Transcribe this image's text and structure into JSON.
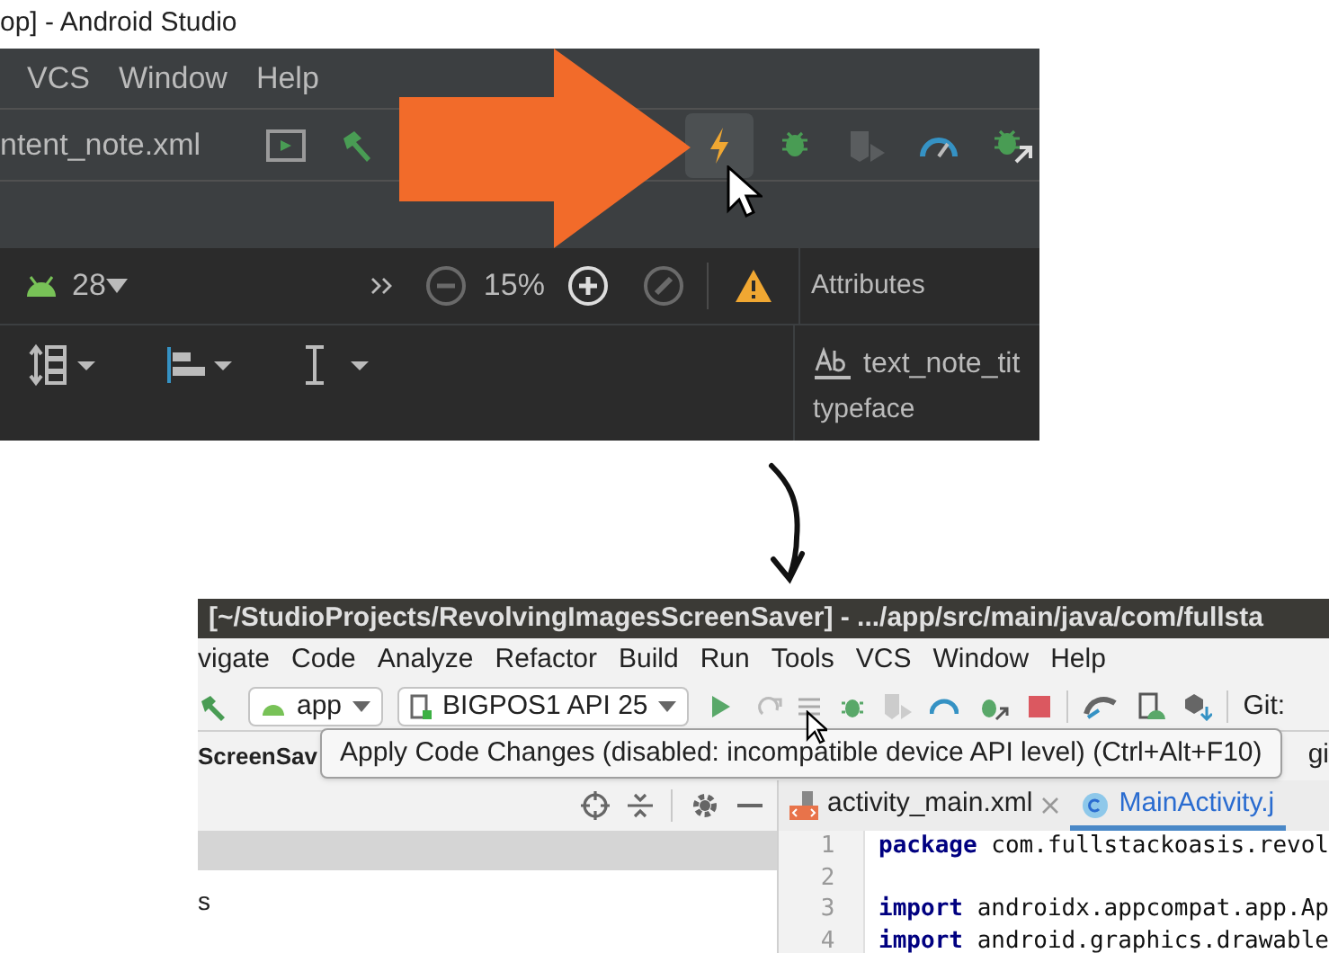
{
  "top_screenshot": {
    "window_title": "op] - Android Studio",
    "menu": [
      "VCS",
      "Window",
      "Help"
    ],
    "file_tab": "ntent_note.xml",
    "api_level": "28",
    "zoom": "15%",
    "panel_title": "Attributes",
    "component": "text_note_tit",
    "attribute": "typeface"
  },
  "bottom_screenshot": {
    "window_title": "[~/StudioProjects/RevolvingImagesScreenSaver] - .../app/src/main/java/com/fullsta",
    "menu": [
      "vigate",
      "Code",
      "Analyze",
      "Refactor",
      "Build",
      "Run",
      "Tools",
      "VCS",
      "Window",
      "Help"
    ],
    "run_config": "app",
    "device": "BIGPOS1 API 25",
    "git_label": "Git:",
    "project_label": "ScreenSav",
    "right_fragment": "gi",
    "tooltip": "Apply Code Changes (disabled: incompatible device API level) (Ctrl+Alt+F10)",
    "tree_item": "s",
    "editor_tabs": [
      {
        "label": "activity_main.xml",
        "selected": false
      },
      {
        "label": "MainActivity.j",
        "selected": true
      }
    ],
    "code_lines": [
      {
        "number": "1",
        "text": "**package** com.fullstackoasis.revol"
      },
      {
        "number": "2"
      },
      {
        "number": "3",
        "text": "**import** androidx.appcompat.app.Ap"
      },
      {
        "number": "4",
        "text": "**import** android.graphics.drawable"
      }
    ]
  }
}
